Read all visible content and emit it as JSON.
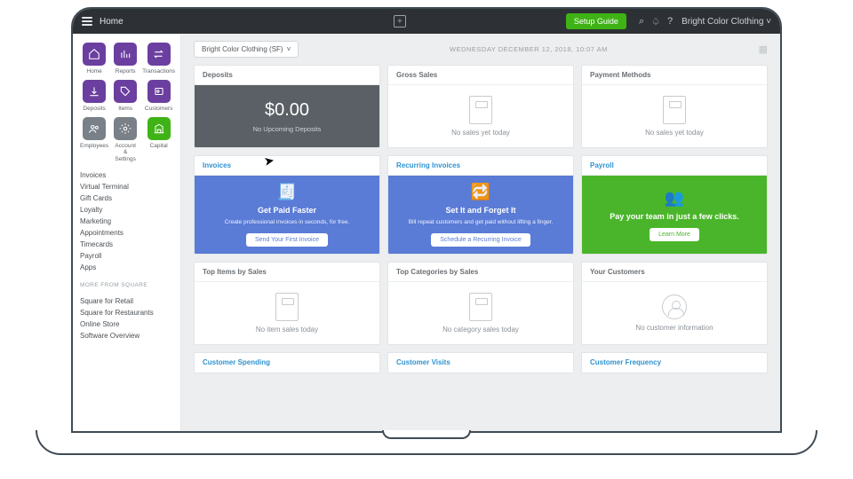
{
  "topbar": {
    "title": "Home",
    "setup": "Setup Guide",
    "account": "Bright Color Clothing"
  },
  "sidebar": {
    "tiles": [
      {
        "label": "Home",
        "color": "c-purple"
      },
      {
        "label": "Reports",
        "color": "c-purple"
      },
      {
        "label": "Transactions",
        "color": "c-purple"
      },
      {
        "label": "Deposits",
        "color": "c-purple"
      },
      {
        "label": "Items",
        "color": "c-purple"
      },
      {
        "label": "Customers",
        "color": "c-purple"
      },
      {
        "label": "Employees",
        "color": "c-gray"
      },
      {
        "label": "Account & Settings",
        "color": "c-gray"
      },
      {
        "label": "Capital",
        "color": "c-green"
      }
    ],
    "links": [
      "Invoices",
      "Virtual Terminal",
      "Gift Cards",
      "Loyalty",
      "Marketing",
      "Appointments",
      "Timecards",
      "Payroll",
      "Apps"
    ],
    "more_head": "More from Square",
    "more": [
      "Square for Retail",
      "Square for Restaurants",
      "Online Store",
      "Software Overview"
    ]
  },
  "main": {
    "location": "Bright Color Clothing (SF)",
    "date": "Wednesday December 12, 2018, 10:07 AM",
    "deposits": {
      "title": "Deposits",
      "amount": "$0.00",
      "sub": "No Upcoming Deposits"
    },
    "gross": {
      "title": "Gross Sales",
      "empty": "No sales yet today"
    },
    "payment": {
      "title": "Payment Methods",
      "empty": "No sales yet today"
    },
    "invoices": {
      "title": "Invoices",
      "ptitle": "Get Paid Faster",
      "pdesc": "Create professional invoices in seconds, for free.",
      "btn": "Send Your First Invoice"
    },
    "recurring": {
      "title": "Recurring Invoices",
      "ptitle": "Set It and Forget It",
      "pdesc": "Bill repeat customers and get paid without lifting a finger.",
      "btn": "Schedule a Recurring Invoice"
    },
    "payroll": {
      "title": "Payroll",
      "ptitle": "Pay your team in just a few clicks.",
      "btn": "Learn More"
    },
    "topitems": {
      "title": "Top Items by Sales",
      "empty": "No item sales today"
    },
    "topcat": {
      "title": "Top Categories by Sales",
      "empty": "No category sales today"
    },
    "customers": {
      "title": "Your Customers",
      "empty": "No customer information"
    },
    "spend": {
      "title": "Customer Spending"
    },
    "visits": {
      "title": "Customer Visits"
    },
    "freq": {
      "title": "Customer Frequency"
    }
  }
}
